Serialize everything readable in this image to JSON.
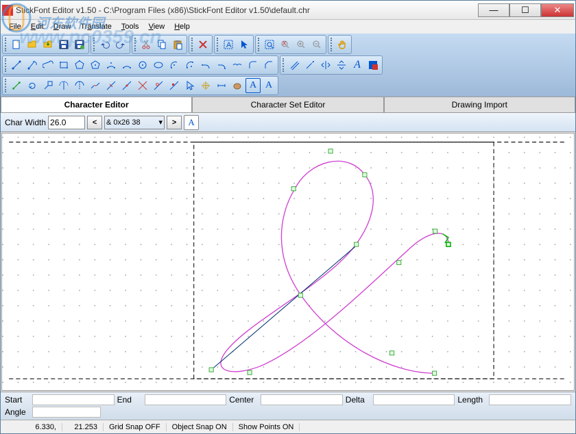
{
  "window": {
    "title": "StickFont Editor v1.50 - C:\\Program Files (x86)\\StickFont Editor v1.50\\default.chr"
  },
  "menus": [
    "File",
    "Edit",
    "Draw",
    "Translate",
    "Tools",
    "View",
    "Help"
  ],
  "tabs": {
    "t1": "Character Editor",
    "t2": "Character Set Editor",
    "t3": "Drawing Import"
  },
  "options": {
    "char_width_label": "Char Width",
    "char_width_value": "26.0",
    "prev": "<",
    "next": ">",
    "char_select": "& 0x26 38"
  },
  "bottom": {
    "start": "Start",
    "end": "End",
    "center": "Center",
    "delta": "Delta",
    "length": "Length",
    "angle": "Angle"
  },
  "status": {
    "coords_x": "6.330,",
    "coords_y": "21.253",
    "grid": "Grid Snap OFF",
    "object": "Object Snap ON",
    "points": "Show Points ON"
  },
  "watermark": "www.pc0359.cn",
  "wm_brand": "河东软件园"
}
